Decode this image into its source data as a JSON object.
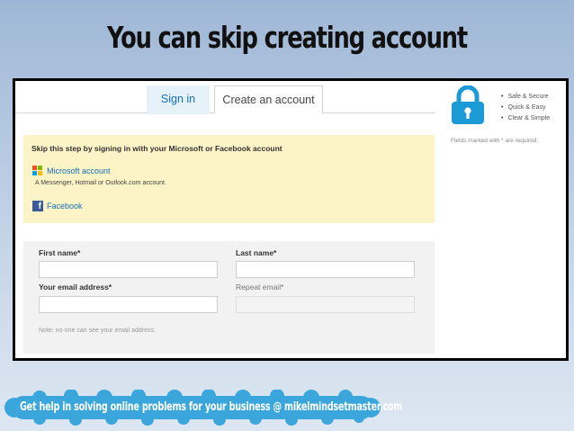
{
  "slide": {
    "title": "You can skip creating account",
    "footer_banner": "Get help in solving online problems for your business @ mikelmindsetmaster.com"
  },
  "tabs": [
    {
      "label": "Sign in",
      "active": false
    },
    {
      "label": "Create an account",
      "active": true
    }
  ],
  "skip_section": {
    "title": "Skip this step by signing in with your Microsoft or Facebook account",
    "microsoft_link": "Microsoft account",
    "microsoft_desc": "A Messenger, Hotmail or Outlook.com account.",
    "facebook_link": "Facebook"
  },
  "form": {
    "first_name_label": "First name*",
    "last_name_label": "Last name*",
    "email_label": "Your email address*",
    "repeat_email_label": "Repeat email*",
    "first_name_value": "",
    "last_name_value": "",
    "email_value": "",
    "repeat_email_value": "",
    "note": "Note: no-one can see your email address."
  },
  "sidebar": {
    "features": [
      "Safe & Secure",
      "Quick & Easy",
      "Clear & Simple"
    ],
    "required_note": "Fields marked with * are required."
  },
  "colors": {
    "link_blue": "#1670b9",
    "skip_bg": "#fcf3c6",
    "form_bg": "#f2f2f2",
    "lock_blue": "#1c9ad6",
    "banner_blue": "#3aa6dc",
    "facebook_blue": "#3b5998"
  }
}
